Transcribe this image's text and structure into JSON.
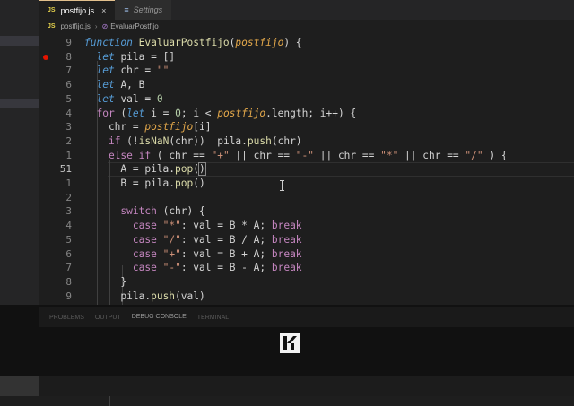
{
  "tabs": [
    {
      "badge": "JS",
      "label": "postfijo.js",
      "close": "×"
    },
    {
      "label": "Settings"
    }
  ],
  "breadcrumb": {
    "file": "postfijo.js",
    "symbol": "EvaluarPostfijo"
  },
  "line_numbers": [
    "9",
    "8",
    "7",
    "6",
    "5",
    "4",
    "3",
    "2",
    "1",
    "51",
    "1",
    "2",
    "3",
    "4",
    "5",
    "6",
    "7",
    "8",
    "9"
  ],
  "current_line_index": 9,
  "code_lines": [
    [
      [
        "kwi",
        "function "
      ],
      [
        "fn",
        "EvaluarPostfijo"
      ],
      [
        "op",
        "("
      ],
      [
        "par",
        "postfijo"
      ],
      [
        "op",
        ") {"
      ]
    ],
    [
      [
        "op",
        "  "
      ],
      [
        "kwi",
        "let"
      ],
      [
        "op",
        " pila = []"
      ]
    ],
    [
      [
        "op",
        "  "
      ],
      [
        "kwi",
        "let"
      ],
      [
        "op",
        " chr = "
      ],
      [
        "str",
        "\"\""
      ]
    ],
    [
      [
        "op",
        "  "
      ],
      [
        "kwi",
        "let"
      ],
      [
        "op",
        " A, B"
      ]
    ],
    [
      [
        "op",
        "  "
      ],
      [
        "kwi",
        "let"
      ],
      [
        "op",
        " val = "
      ],
      [
        "num",
        "0"
      ]
    ],
    [
      [
        "op",
        "  "
      ],
      [
        "ctl",
        "for"
      ],
      [
        "op",
        " ("
      ],
      [
        "kwi",
        "let"
      ],
      [
        "op",
        " i = "
      ],
      [
        "num",
        "0"
      ],
      [
        "op",
        "; i < "
      ],
      [
        "par",
        "postfijo"
      ],
      [
        "op",
        ".length; i++) {"
      ]
    ],
    [
      [
        "op",
        "    chr = "
      ],
      [
        "par",
        "postfijo"
      ],
      [
        "op",
        "[i]"
      ]
    ],
    [
      [
        "op",
        "    "
      ],
      [
        "ctl",
        "if"
      ],
      [
        "op",
        " (!"
      ],
      [
        "fn",
        "isNaN"
      ],
      [
        "op",
        "(chr))  pila."
      ],
      [
        "fn",
        "push"
      ],
      [
        "op",
        "(chr)"
      ]
    ],
    [
      [
        "op",
        "    "
      ],
      [
        "ctl",
        "else if"
      ],
      [
        "op",
        " ( chr == "
      ],
      [
        "str",
        "\"+\""
      ],
      [
        "op",
        " || chr == "
      ],
      [
        "str",
        "\"-\""
      ],
      [
        "op",
        " || chr == "
      ],
      [
        "str",
        "\"*\""
      ],
      [
        "op",
        " || chr == "
      ],
      [
        "str",
        "\"/\""
      ],
      [
        "op",
        " ) {"
      ]
    ],
    [
      [
        "op",
        "      A = pila."
      ],
      [
        "fn",
        "pop"
      ],
      [
        "op",
        "("
      ],
      [
        "brk",
        ")"
      ]
    ],
    [
      [
        "op",
        "      B = pila."
      ],
      [
        "fn",
        "pop"
      ],
      [
        "op",
        "()"
      ]
    ],
    [
      [
        "op",
        ""
      ]
    ],
    [
      [
        "op",
        "      "
      ],
      [
        "ctl",
        "switch"
      ],
      [
        "op",
        " (chr) {"
      ]
    ],
    [
      [
        "op",
        "        "
      ],
      [
        "ctl",
        "case"
      ],
      [
        "op",
        " "
      ],
      [
        "str",
        "\"*\""
      ],
      [
        "op",
        ": val = B * A; "
      ],
      [
        "ctl",
        "break"
      ]
    ],
    [
      [
        "op",
        "        "
      ],
      [
        "ctl",
        "case"
      ],
      [
        "op",
        " "
      ],
      [
        "str",
        "\"/\""
      ],
      [
        "op",
        ": val = B / A; "
      ],
      [
        "ctl",
        "break"
      ]
    ],
    [
      [
        "op",
        "        "
      ],
      [
        "ctl",
        "case"
      ],
      [
        "op",
        " "
      ],
      [
        "str",
        "\"+\""
      ],
      [
        "op",
        ": val = B + A; "
      ],
      [
        "ctl",
        "break"
      ]
    ],
    [
      [
        "op",
        "        "
      ],
      [
        "ctl",
        "case"
      ],
      [
        "op",
        " "
      ],
      [
        "str",
        "\"-\""
      ],
      [
        "op",
        ": val = B - A; "
      ],
      [
        "ctl",
        "break"
      ]
    ],
    [
      [
        "op",
        "      }"
      ]
    ],
    [
      [
        "op",
        "      pila."
      ],
      [
        "fn",
        "push"
      ],
      [
        "op",
        "(val)"
      ]
    ]
  ],
  "panel_tabs": [
    {
      "label": "PROBLEMS"
    },
    {
      "label": "OUTPUT"
    },
    {
      "label": "DEBUG CONSOLE",
      "active": true
    },
    {
      "label": "TERMINAL"
    }
  ],
  "colors": {
    "accent_tab_border": "#e2c08d",
    "breakpoint": "#e51400",
    "background": "#1e1e1e"
  }
}
